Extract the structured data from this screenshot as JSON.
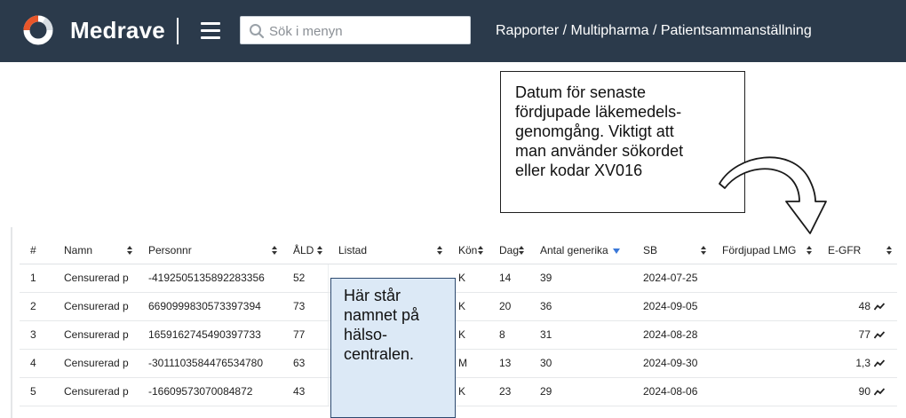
{
  "app": {
    "brand": "Medrave",
    "search_placeholder": "Sök i menyn",
    "breadcrumb": "Rapporter / Multipharma / Patientsammanställning"
  },
  "callouts": {
    "lmg_note": [
      "Datum för senaste",
      "fördjupade läkemedels-",
      "genomgång. Viktigt att",
      "man använder sökordet",
      "eller kodar XV016"
    ],
    "vardcentral_note": [
      "Här står",
      "namnet på",
      "hälso-",
      "centralen."
    ]
  },
  "table": {
    "columns": [
      "#",
      "Namn",
      "Personnr",
      "ÅLD",
      "Listad",
      "Kön",
      "Dag",
      "Antal generika",
      "SB",
      "Fördjupad LMG",
      "E-GFR"
    ],
    "rows": [
      {
        "num": "1",
        "namn": "Censurerad p",
        "personnr": "-4192505135892283356",
        "ald": "52",
        "listad": "",
        "kon": "K",
        "dag": "14",
        "generika": "39",
        "sb": "2024-07-25",
        "lmg": "",
        "egfr": ""
      },
      {
        "num": "2",
        "namn": "Censurerad p",
        "personnr": "6690999830573397394",
        "ald": "73",
        "listad": "",
        "kon": "K",
        "dag": "20",
        "generika": "36",
        "sb": "2024-09-05",
        "lmg": "",
        "egfr": "48"
      },
      {
        "num": "3",
        "namn": "Censurerad p",
        "personnr": "1659162745490397733",
        "ald": "77",
        "listad": "",
        "kon": "K",
        "dag": "8",
        "generika": "31",
        "sb": "2024-08-28",
        "lmg": "",
        "egfr": "77"
      },
      {
        "num": "4",
        "namn": "Censurerad p",
        "personnr": "-3011103584476534780",
        "ald": "63",
        "listad": "",
        "kon": "M",
        "dag": "13",
        "generika": "30",
        "sb": "2024-09-30",
        "lmg": "",
        "egfr": "1,3"
      },
      {
        "num": "5",
        "namn": "Censurerad p",
        "personnr": "-16609573070084872",
        "ald": "43",
        "listad": "",
        "kon": "K",
        "dag": "23",
        "generika": "29",
        "sb": "2024-08-06",
        "lmg": "",
        "egfr": "90"
      }
    ]
  },
  "colors": {
    "topbar": "#2b3a4b",
    "logo_orange": "#e8562a",
    "callout_blue_fill": "#dce9f6",
    "sort_active": "#3a78d8"
  }
}
